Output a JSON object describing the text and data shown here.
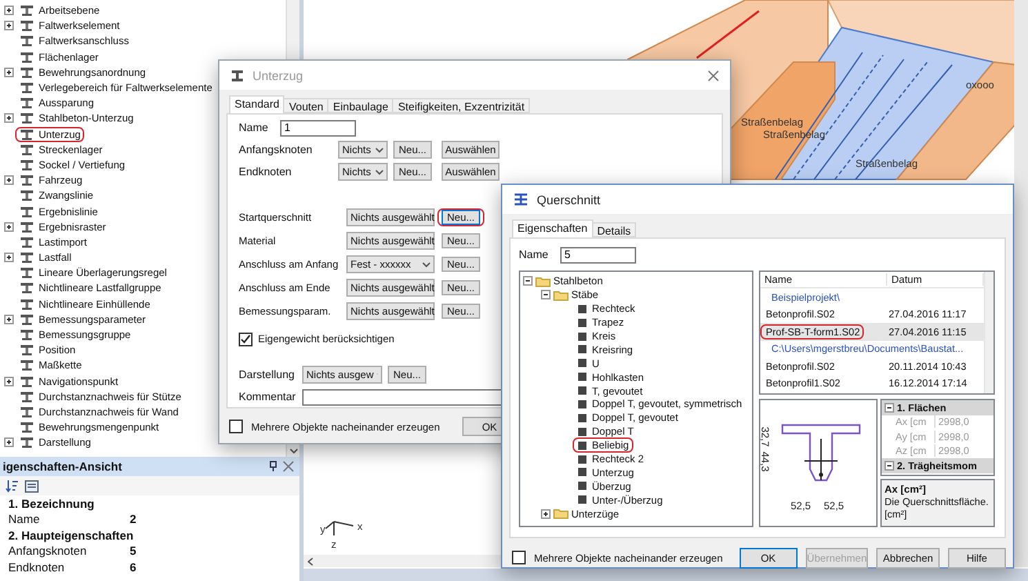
{
  "element_tree": {
    "items": [
      {
        "label": "Arbeitsebene",
        "expandable": true,
        "highlighted": false
      },
      {
        "label": "Faltwerkselement",
        "expandable": true,
        "highlighted": false
      },
      {
        "label": "Faltwerksanschluss",
        "expandable": false,
        "highlighted": false
      },
      {
        "label": "Flächenlager",
        "expandable": false,
        "highlighted": false
      },
      {
        "label": "Bewehrungsanordnung",
        "expandable": true,
        "highlighted": false
      },
      {
        "label": "Verlegebereich für Faltwerkselemente",
        "expandable": false,
        "highlighted": false
      },
      {
        "label": "Aussparung",
        "expandable": false,
        "highlighted": false
      },
      {
        "label": "Stahlbeton-Unterzug",
        "expandable": true,
        "highlighted": false
      },
      {
        "label": "Unterzug",
        "expandable": false,
        "highlighted": true
      },
      {
        "label": "Streckenlager",
        "expandable": false,
        "highlighted": false
      },
      {
        "label": "Sockel / Vertiefung",
        "expandable": false,
        "highlighted": false
      },
      {
        "label": "Fahrzeug",
        "expandable": true,
        "highlighted": false
      },
      {
        "label": "Zwangslinie",
        "expandable": false,
        "highlighted": false
      },
      {
        "label": "Ergebnislinie",
        "expandable": false,
        "highlighted": false
      },
      {
        "label": "Ergebnisraster",
        "expandable": true,
        "highlighted": false
      },
      {
        "label": "Lastimport",
        "expandable": false,
        "highlighted": false
      },
      {
        "label": "Lastfall",
        "expandable": true,
        "highlighted": false
      },
      {
        "label": "Lineare Überlagerungsregel",
        "expandable": false,
        "highlighted": false
      },
      {
        "label": "Nichtlineare Lastfallgruppe",
        "expandable": false,
        "highlighted": false
      },
      {
        "label": "Nichtlineare Einhüllende",
        "expandable": false,
        "highlighted": false
      },
      {
        "label": "Bemessungsparameter",
        "expandable": true,
        "highlighted": false
      },
      {
        "label": "Bemessungsgruppe",
        "expandable": false,
        "highlighted": false
      },
      {
        "label": "Position",
        "expandable": false,
        "highlighted": false
      },
      {
        "label": "Maßkette",
        "expandable": false,
        "highlighted": false
      },
      {
        "label": "Navigationspunkt",
        "expandable": true,
        "highlighted": false
      },
      {
        "label": "Durchstanznachweis für Stütze",
        "expandable": false,
        "highlighted": false
      },
      {
        "label": "Durchstanznachweis für Wand",
        "expandable": false,
        "highlighted": false
      },
      {
        "label": "Bewehrungsmengenpunkt",
        "expandable": false,
        "highlighted": false
      },
      {
        "label": "Darstellung",
        "expandable": true,
        "highlighted": false
      }
    ]
  },
  "properties_panel": {
    "title": "igenschaften-Ansicht",
    "rows": [
      {
        "kind": "category",
        "label": "1. Bezeichnung"
      },
      {
        "kind": "property",
        "label": "Name",
        "value": "2"
      },
      {
        "kind": "category",
        "label": "2. Haupteigenschaften"
      },
      {
        "kind": "property",
        "label": "Anfangsknoten",
        "value": "5"
      },
      {
        "kind": "property",
        "label": "Endknoten",
        "value": "6"
      }
    ]
  },
  "model_view": {
    "labels": [
      "Straßenbelag",
      "Straßenbelag",
      "Straßenbelag",
      "oxooo"
    ],
    "axes": [
      "y",
      "x",
      "z"
    ]
  },
  "unterzug_dialog": {
    "title": "Unterzug",
    "tabs": [
      {
        "label": "Standard",
        "selected": true
      },
      {
        "label": "Vouten",
        "selected": false
      },
      {
        "label": "Einbaulage",
        "selected": false
      },
      {
        "label": "Steifigkeiten, Exzentrizität",
        "selected": false
      }
    ],
    "name": {
      "label": "Name",
      "value": "1"
    },
    "node_rows": [
      {
        "label": "Anfangsknoten",
        "value": "Nichts",
        "new_button": "Neu...",
        "select_button": "Auswählen"
      },
      {
        "label": "Endknoten",
        "value": "Nichts",
        "new_button": "Neu...",
        "select_button": "Auswählen"
      }
    ],
    "reference_rows": [
      {
        "label": "Startquerschnitt",
        "value": "Nichts ausgewählt",
        "button": "Neu...",
        "highlighted": true
      },
      {
        "label": "Material",
        "value": "Nichts ausgewählt",
        "button": "Neu...",
        "highlighted": false
      },
      {
        "label": "Anschluss am Anfang",
        "value": "Fest - xxxxxx",
        "button": "Neu...",
        "highlighted": false
      },
      {
        "label": "Anschluss am Ende",
        "value": "Nichts ausgewählt",
        "button": "Neu...",
        "highlighted": false
      },
      {
        "label": "Bemessungsparam.",
        "value": "Nichts ausgewählt",
        "button": "Neu...",
        "highlighted": false
      }
    ],
    "self_weight": {
      "label": "Eigengewicht berücksichtigen",
      "checked": true
    },
    "display": {
      "label": "Darstellung",
      "value": "Nichts ausgew",
      "button": "Neu..."
    },
    "comment": {
      "label": "Kommentar"
    },
    "multiple": {
      "label": "Mehrere Objekte nacheinander erzeugen",
      "checked": false
    },
    "buttons": [
      {
        "label": "OK"
      }
    ]
  },
  "querschnitt_dialog": {
    "title": "Querschnitt",
    "tabs": [
      {
        "label": "Eigenschaften",
        "selected": true
      },
      {
        "label": "Details",
        "selected": false
      }
    ],
    "name": {
      "label": "Name",
      "value": "5"
    },
    "tree": [
      {
        "label": "Stahlbeton",
        "kind": "folder",
        "expanded": true,
        "children": [
          {
            "label": "Stäbe",
            "kind": "folder",
            "expanded": true,
            "children": [
              {
                "label": "Rechteck",
                "highlighted": false
              },
              {
                "label": "Trapez",
                "highlighted": false
              },
              {
                "label": "Kreis",
                "highlighted": false
              },
              {
                "label": "Kreisring",
                "highlighted": false
              },
              {
                "label": "U",
                "highlighted": false
              },
              {
                "label": "Hohlkasten",
                "highlighted": false
              },
              {
                "label": "T, gevoutet",
                "highlighted": false
              },
              {
                "label": "Doppel T, gevoutet, symmetrisch",
                "highlighted": false
              },
              {
                "label": "Doppel T, gevoutet",
                "highlighted": false
              },
              {
                "label": "Doppel T",
                "highlighted": false
              },
              {
                "label": "Beliebig",
                "highlighted": true
              },
              {
                "label": "Rechteck 2",
                "highlighted": false
              },
              {
                "label": "Unterzug",
                "highlighted": false
              },
              {
                "label": "Überzug",
                "highlighted": false
              },
              {
                "label": "Unter-/Überzug",
                "highlighted": false
              }
            ]
          },
          {
            "label": "Unterzüge",
            "kind": "folder",
            "expanded": false
          }
        ]
      }
    ],
    "files": {
      "columns": [
        "Name",
        "Datum"
      ],
      "rows": [
        {
          "kind": "folder",
          "name": "Beispielprojekt\\"
        },
        {
          "kind": "file",
          "name": "Betonprofil.S02",
          "date": "27.04.2016 11:17",
          "selected": false,
          "highlighted": false
        },
        {
          "kind": "file",
          "name": "Prof-SB-T-form1.S02",
          "date": "27.04.2016 11:15",
          "selected": true,
          "highlighted": true
        },
        {
          "kind": "folder",
          "name": "C:\\Users\\mgerstbreu\\Documents\\Baustat..."
        },
        {
          "kind": "file",
          "name": "Betonprofil.S02",
          "date": "20.11.2014 10:43",
          "selected": false,
          "highlighted": false
        },
        {
          "kind": "file",
          "name": "Betonprofil1.S02",
          "date": "16.12.2014 17:14",
          "selected": false,
          "highlighted": false
        }
      ]
    },
    "preview": {
      "vertical_dims": [
        "32,7",
        "44,3"
      ],
      "horizontal_dims": [
        "52,5",
        "52,5"
      ]
    },
    "property_grid": {
      "rows": [
        {
          "kind": "category",
          "label": "1. Flächen",
          "expanded": true
        },
        {
          "kind": "property",
          "label": "Ax [cm",
          "value": "2998,0"
        },
        {
          "kind": "property",
          "label": "Ay [cm",
          "value": "2998,0"
        },
        {
          "kind": "property",
          "label": "Az [cm",
          "value": "2998,0"
        },
        {
          "kind": "category",
          "label": "2. Trägheitsmom",
          "expanded": true
        }
      ]
    },
    "description": {
      "title": "Ax [cm²]",
      "text": "Die Querschnittsfläche. [cm²]"
    },
    "multiple": {
      "label": "Mehrere Objekte nacheinander erzeugen",
      "checked": false
    },
    "buttons": [
      {
        "label": "OK",
        "disabled": false
      },
      {
        "label": "Übernehmen",
        "disabled": true
      },
      {
        "label": "Abbrechen",
        "disabled": false
      },
      {
        "label": "Hilfe",
        "disabled": false
      }
    ]
  }
}
